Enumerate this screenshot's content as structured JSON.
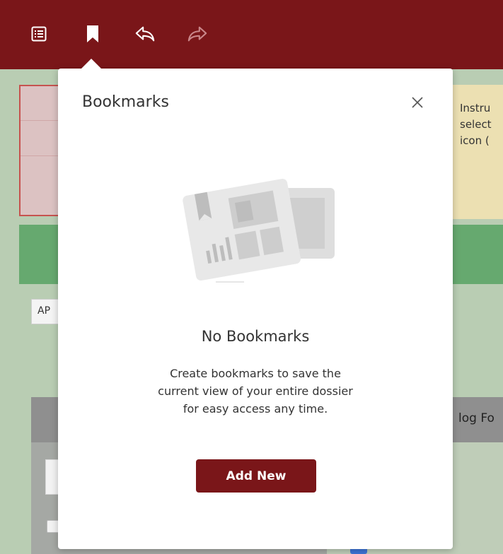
{
  "toolbar": {
    "icons": [
      "table-of-contents-icon",
      "bookmark-icon",
      "undo-icon",
      "redo-icon"
    ],
    "background_color": "#7a1619"
  },
  "background": {
    "instructions_text": "Instru\nselect\nicon (",
    "ap_text": "AP",
    "log_text": "log Fo"
  },
  "bookmarks_popover": {
    "title": "Bookmarks",
    "empty_title": "No Bookmarks",
    "empty_description_lines": [
      "Create bookmarks to save the",
      "current view of your entire dossier",
      "for easy access any time."
    ],
    "add_button_label": "Add New",
    "accent_color": "#7a1619"
  }
}
